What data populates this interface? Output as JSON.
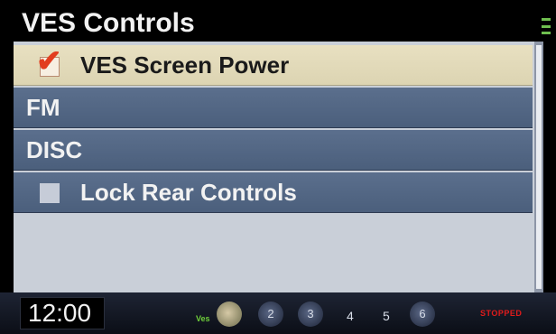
{
  "header": {
    "title": "VES Controls"
  },
  "menu": {
    "items": [
      {
        "label": "VES Screen Power",
        "selected": true,
        "checkbox": "checked"
      },
      {
        "label": "FM",
        "selected": false,
        "checkbox": "none"
      },
      {
        "label": "DISC",
        "selected": false,
        "checkbox": "none"
      },
      {
        "label": "Lock Rear Controls",
        "selected": false,
        "checkbox": "unchecked"
      }
    ]
  },
  "status_bar": {
    "clock": "12:00",
    "ves_label": "Ves",
    "slots": [
      "2",
      "3",
      "4",
      "5",
      "6"
    ],
    "playback_status": "STOPPED"
  },
  "colors": {
    "selected_row": "#e8e0c1",
    "row": "#52668a",
    "check_accent": "#e23d1f",
    "status_red": "#e01b1b"
  }
}
